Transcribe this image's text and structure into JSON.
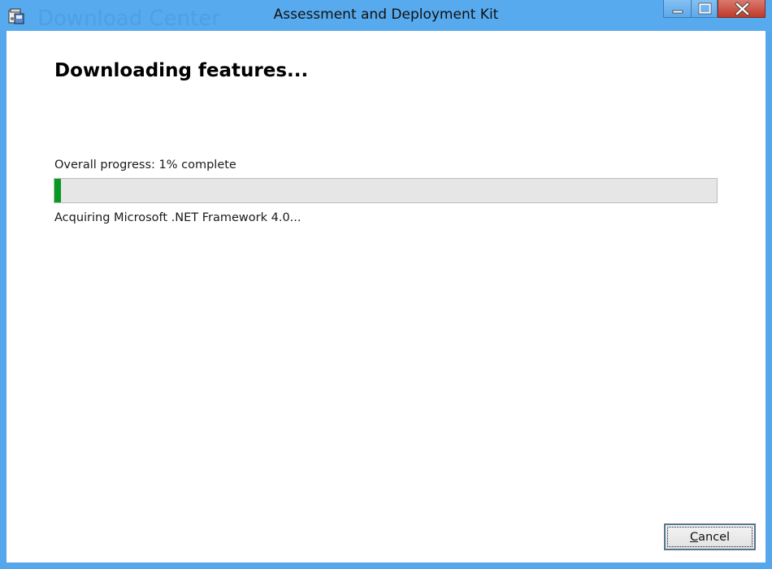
{
  "window": {
    "title": "Assessment and Deployment Kit",
    "background_title": "Download Center",
    "accent_color": "#55a6ea"
  },
  "caption_buttons": {
    "minimize_icon": "minimize-icon",
    "maximize_icon": "maximize-icon",
    "close_icon": "close-icon"
  },
  "main": {
    "heading": "Downloading features...",
    "progress_label": "Overall progress: 1% complete",
    "progress_percent": 1,
    "progress_color": "#069a23",
    "status": "Acquiring Microsoft .NET Framework 4.0..."
  },
  "footer": {
    "cancel_label": "Cancel"
  }
}
